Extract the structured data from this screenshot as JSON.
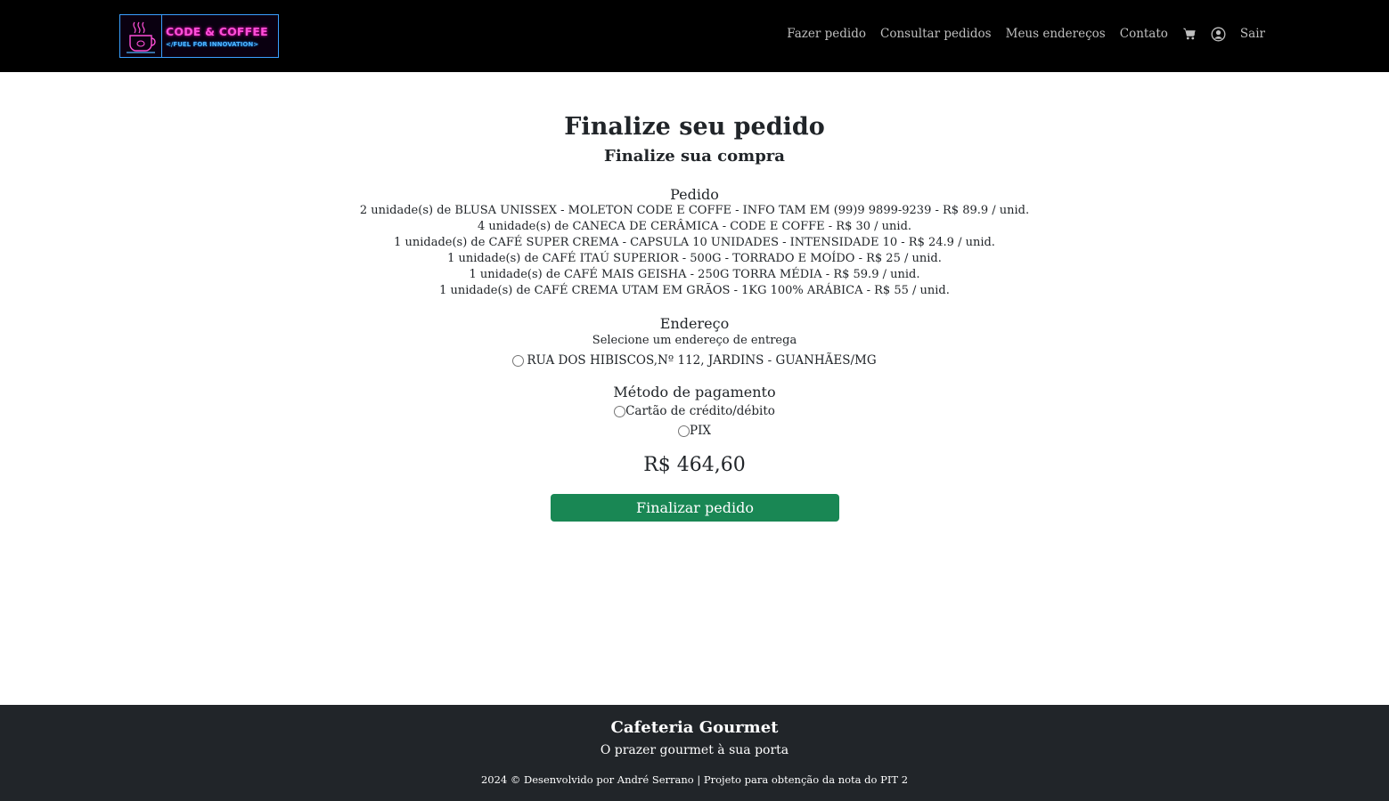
{
  "brand": {
    "logo_title": "CODE & COFFEE",
    "logo_subtitle": "</FUEL FOR INNOVATION>",
    "colors": {
      "title": "#ff4fd8",
      "subtitle": "#4fb4ff",
      "border": "#3aa0ff"
    }
  },
  "nav": {
    "links": [
      "Fazer pedido",
      "Consultar pedidos",
      "Meus endereços",
      "Contato"
    ],
    "cart_icon": "cart-icon",
    "user_icon": "user-circle-icon",
    "logout": "Sair"
  },
  "page": {
    "title": "Finalize seu pedido",
    "subtitle": "Finalize sua compra"
  },
  "order": {
    "heading": "Pedido",
    "items": [
      "2 unidade(s) de BLUSA UNISSEX - MOLETON CODE E COFFE - INFO TAM EM (99)9 9899-9239 - R$ 89.9 / unid.",
      "4 unidade(s) de CANECA DE CERÂMICA - CODE E COFFE - R$ 30 / unid.",
      "1 unidade(s) de CAFÉ SUPER CREMA - CAPSULA 10 UNIDADES - INTENSIDADE 10 - R$ 24.9 / unid.",
      "1 unidade(s) de CAFÉ ITAÚ SUPERIOR - 500G - TORRADO E MOÍDO - R$ 25 / unid.",
      "1 unidade(s) de CAFÉ MAIS GEISHA - 250G TORRA MÉDIA - R$ 59.9 / unid.",
      "1 unidade(s) de CAFÉ CREMA UTAM EM GRÃOS - 1KG 100% ARÁBICA - R$ 55 / unid."
    ]
  },
  "address": {
    "heading": "Endereço",
    "instruction": "Selecione um endereço de entrega",
    "options": [
      "RUA DOS HIBISCOS,Nº 112, JARDINS - GUANHÃES/MG"
    ]
  },
  "payment": {
    "heading": "Método de pagamento",
    "options": [
      "Cartão de crédito/débito",
      "PIX"
    ]
  },
  "total": "R$ 464,60",
  "submit_label": "Finalizar pedido",
  "colors": {
    "primary_button": "#198754",
    "footer_bg": "#212529",
    "navbar_bg": "#000000"
  },
  "footer": {
    "title": "Cafeteria Gourmet",
    "tagline": "O prazer gourmet à sua porta",
    "copyright": "2024 © Desenvolvido por André Serrano | Projeto para obtenção da nota do PIT 2"
  }
}
